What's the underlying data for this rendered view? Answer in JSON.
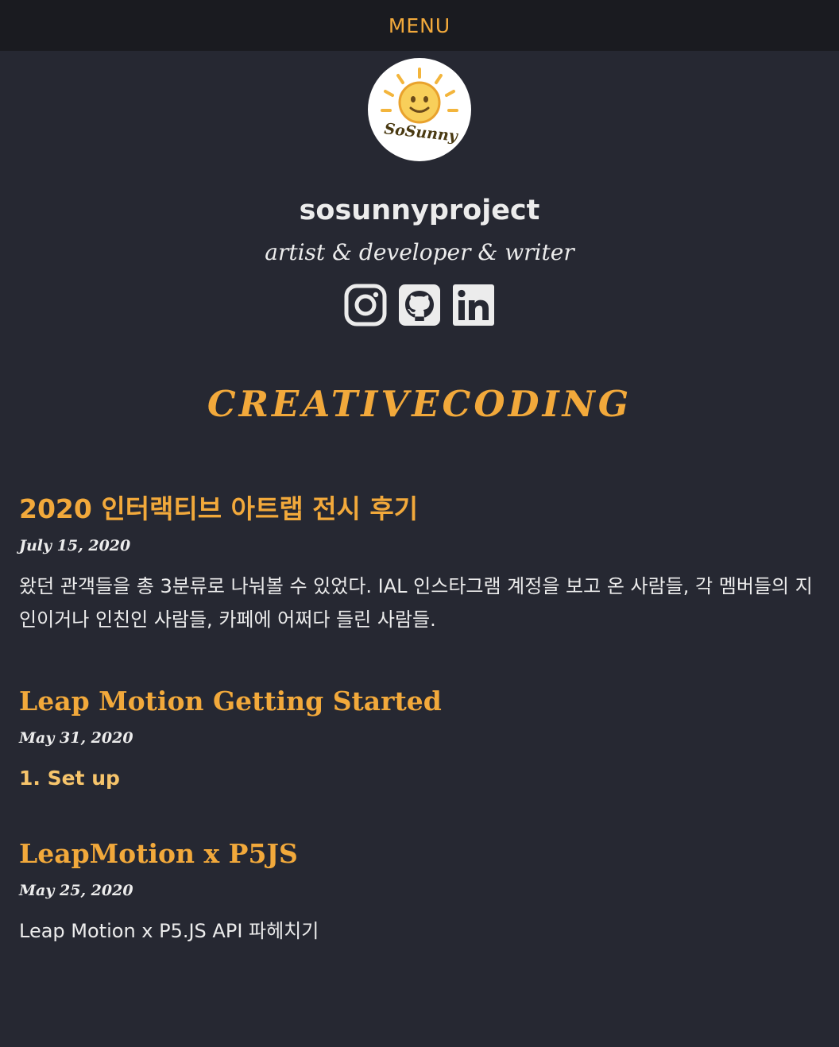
{
  "nav": {
    "menu_label": "MENU"
  },
  "profile": {
    "avatar_logo_text": "SoSunny",
    "name": "sosunnyproject",
    "tagline": "artist & developer & writer"
  },
  "social": [
    {
      "icon": "instagram-icon"
    },
    {
      "icon": "github-icon"
    },
    {
      "icon": "linkedin-icon"
    }
  ],
  "section": {
    "heading": "CREATIVECODING"
  },
  "posts": [
    {
      "title": "2020 인터랙티브 아트랩 전시 후기",
      "date": "July 15, 2020",
      "excerpt": "왔던 관객들을 총 3분류로 나눠볼 수 있었다. IAL 인스타그램 계정을 보고 온 사람들, 각 멤버들의 지인이거나 인친인 사람들, 카페에 어쩌다 들린 사람들."
    },
    {
      "title": "Leap Motion Getting Started",
      "date": "May 31, 2020",
      "excerpt": "1. Set up"
    },
    {
      "title": "LeapMotion x P5JS",
      "date": "May 25, 2020",
      "excerpt": "Leap Motion x P5.JS API 파헤치기"
    }
  ],
  "colors": {
    "background": "#262832",
    "topbar": "#1a1b20",
    "accent": "#f2a93b",
    "text": "#ececec"
  }
}
